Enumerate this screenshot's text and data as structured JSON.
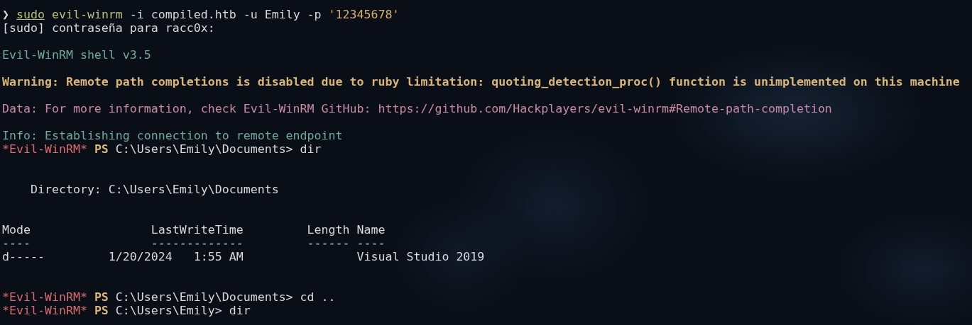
{
  "terminal": {
    "lines": [
      {
        "kind": "text",
        "segments": [
          {
            "kind": "prompt",
            "text": "❯ "
          },
          {
            "kind": "command-underlined",
            "text": "sudo"
          },
          {
            "kind": "command",
            "text": " evil-winrm"
          },
          {
            "kind": "plain",
            "text": " -i compiled.htb -u Emily -p "
          },
          {
            "kind": "string",
            "text": "'12345678'"
          }
        ]
      },
      {
        "kind": "text",
        "segments": [
          {
            "kind": "plain",
            "text": "[sudo] contraseña para racc0x:"
          }
        ]
      },
      {
        "kind": "blank"
      },
      {
        "kind": "text",
        "segments": [
          {
            "kind": "info",
            "text": "Evil-WinRM shell v3.5"
          }
        ]
      },
      {
        "kind": "blank"
      },
      {
        "kind": "text",
        "segments": [
          {
            "kind": "warning",
            "text": "Warning: Remote path completions is disabled due to ruby limitation: quoting_detection_proc() function is unimplemented on this machine"
          }
        ]
      },
      {
        "kind": "blank"
      },
      {
        "kind": "text",
        "segments": [
          {
            "kind": "data",
            "text": "Data: For more information, check Evil-WinRM GitHub: https://github.com/Hackplayers/evil-winrm#Remote-path-completion"
          }
        ]
      },
      {
        "kind": "blank"
      },
      {
        "kind": "text",
        "segments": [
          {
            "kind": "info",
            "text": "Info: Establishing connection to remote endpoint"
          }
        ]
      },
      {
        "kind": "text",
        "segments": [
          {
            "kind": "shell-name",
            "text": "*Evil-WinRM* "
          },
          {
            "kind": "ps",
            "text": "PS"
          },
          {
            "kind": "plain",
            "text": " C:\\Users\\Emily\\Documents> dir"
          }
        ]
      },
      {
        "kind": "blank"
      },
      {
        "kind": "blank"
      },
      {
        "kind": "text",
        "segments": [
          {
            "kind": "plain",
            "text": "    Directory: C:\\Users\\Emily\\Documents"
          }
        ]
      },
      {
        "kind": "blank"
      },
      {
        "kind": "blank"
      },
      {
        "kind": "text",
        "segments": [
          {
            "kind": "plain",
            "text": "Mode                 LastWriteTime         Length Name"
          }
        ]
      },
      {
        "kind": "text",
        "segments": [
          {
            "kind": "plain",
            "text": "----                 -------------         ------ ----"
          }
        ]
      },
      {
        "kind": "text",
        "segments": [
          {
            "kind": "plain",
            "text": "d-----         1/20/2024   1:55 AM                Visual Studio 2019"
          }
        ]
      },
      {
        "kind": "blank"
      },
      {
        "kind": "blank"
      },
      {
        "kind": "text",
        "segments": [
          {
            "kind": "shell-name",
            "text": "*Evil-WinRM* "
          },
          {
            "kind": "ps",
            "text": "PS"
          },
          {
            "kind": "plain",
            "text": " C:\\Users\\Emily\\Documents> cd .."
          }
        ]
      },
      {
        "kind": "text",
        "segments": [
          {
            "kind": "shell-name",
            "text": "*Evil-WinRM* "
          },
          {
            "kind": "ps",
            "text": "PS"
          },
          {
            "kind": "plain",
            "text": " C:\\Users\\Emily> dir"
          }
        ]
      }
    ]
  }
}
